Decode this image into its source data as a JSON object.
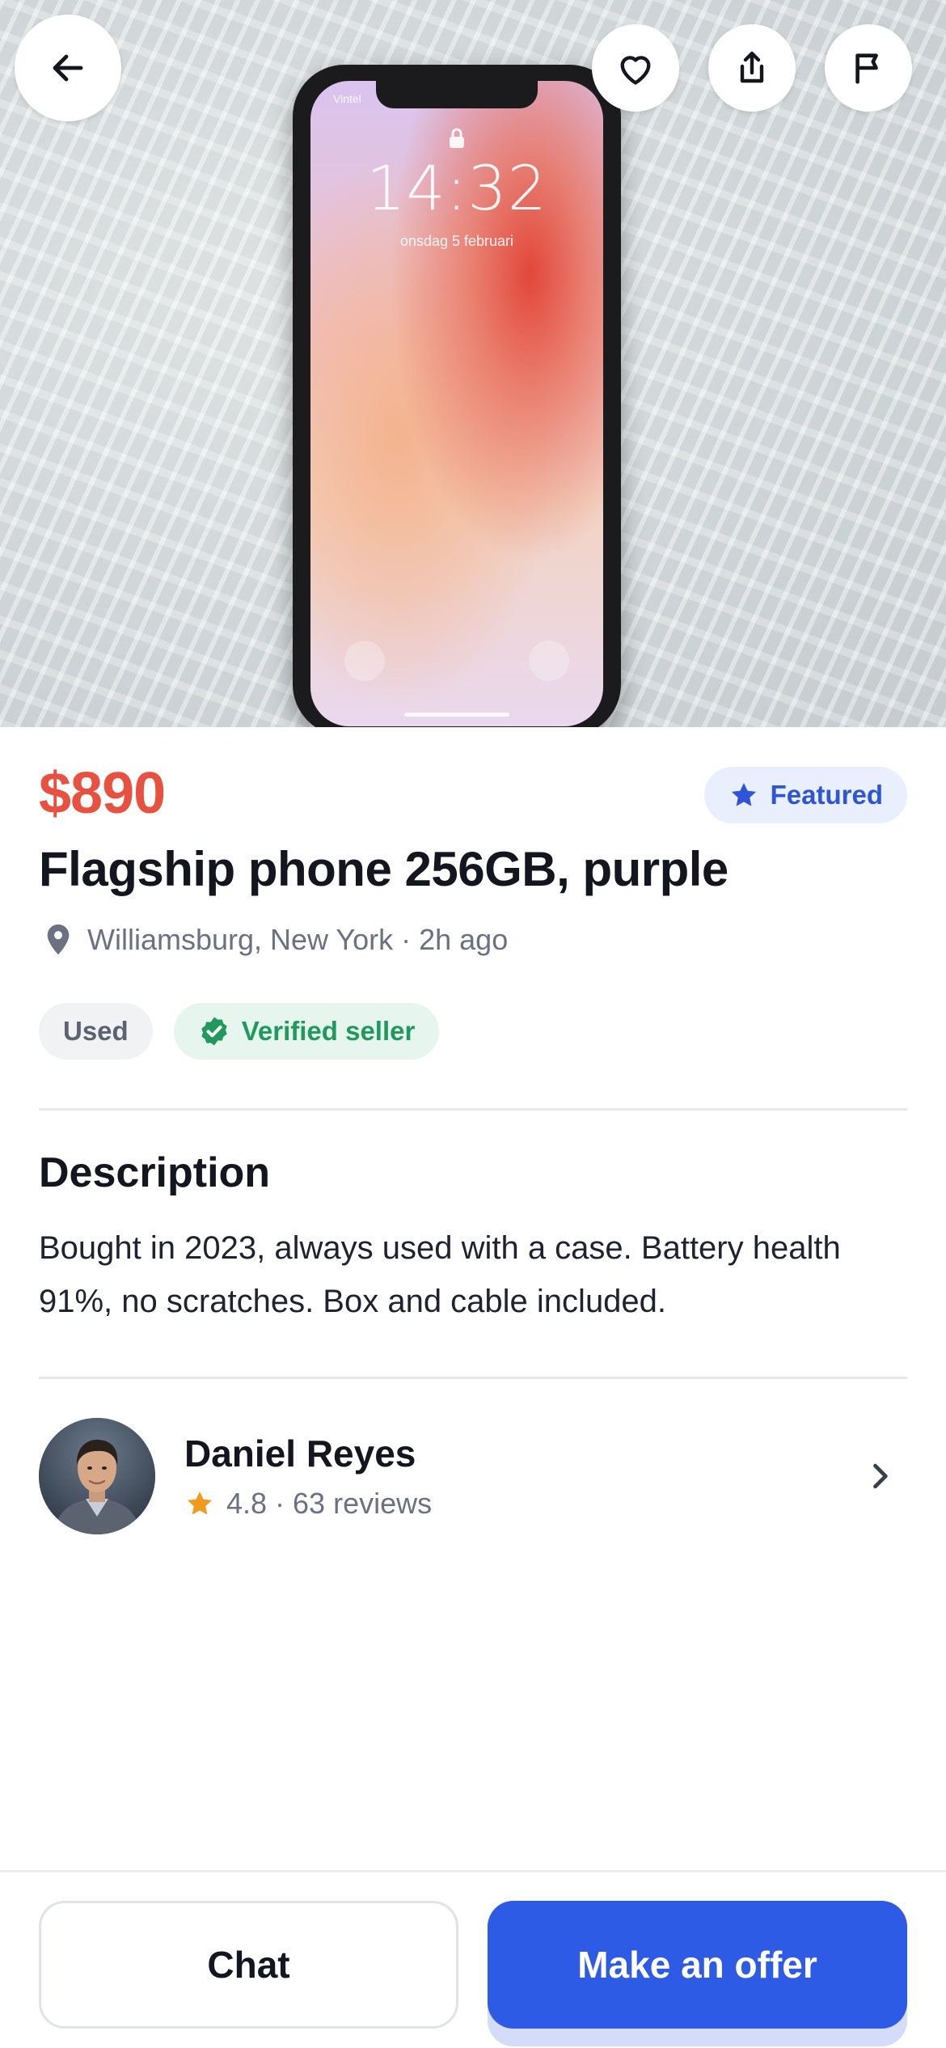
{
  "hero": {
    "phone_screen": {
      "carrier": "Vintel",
      "time": "14:32",
      "date": "onsdag 5 februari"
    }
  },
  "listing": {
    "price": "$890",
    "badge": "Featured",
    "title": "Flagship phone 256GB, purple",
    "location": "Williamsburg, New York",
    "posted": "2h ago",
    "location_line": "Williamsburg, New York · 2h ago",
    "chips": {
      "condition": "Used",
      "verified": "Verified seller"
    }
  },
  "description": {
    "heading": "Description",
    "text": "Bought in 2023, always used with a case. Battery health 91%, no scratches. Box and cable included."
  },
  "seller": {
    "name": "Daniel Reyes",
    "rating": "4.8",
    "reviews": "63 reviews",
    "meta_line": "4.8 · 63 reviews"
  },
  "actions": {
    "chat_label": "Chat",
    "offer_label": "Make an offer"
  },
  "icons": {
    "back": "arrow-left-icon",
    "favorite": "heart-icon",
    "share": "share-icon",
    "report": "flag-icon",
    "location": "map-pin-icon",
    "featured": "star-icon",
    "verified": "verified-badge-icon",
    "rating": "star-icon",
    "chevron": "chevron-right-icon"
  },
  "colors": {
    "price": "#e8503f",
    "primary": "#2e5be6",
    "featured_bg": "#e9effd",
    "verified": "#1f9a5c",
    "rating_star": "#f29a1e"
  }
}
